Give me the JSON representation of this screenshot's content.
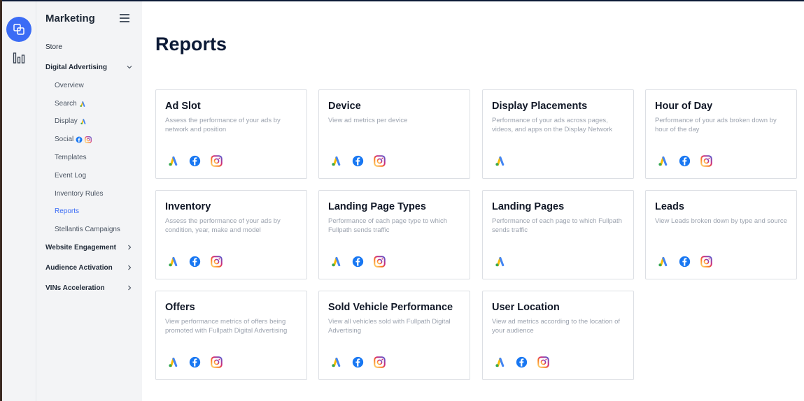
{
  "sidebar": {
    "title": "Marketing",
    "items": [
      {
        "label": "Store",
        "level": 0,
        "expandable": false
      },
      {
        "label": "Digital Advertising",
        "level": 0,
        "expandable": true,
        "expanded": true
      },
      {
        "label": "Overview",
        "level": 1
      },
      {
        "label": "Search",
        "level": 1,
        "icons": [
          "google-ads-icon"
        ]
      },
      {
        "label": "Display",
        "level": 1,
        "icons": [
          "google-ads-icon"
        ]
      },
      {
        "label": "Social",
        "level": 1,
        "icons": [
          "facebook-icon",
          "instagram-icon"
        ]
      },
      {
        "label": "Templates",
        "level": 1
      },
      {
        "label": "Event Log",
        "level": 1
      },
      {
        "label": "Inventory Rules",
        "level": 1
      },
      {
        "label": "Reports",
        "level": 1,
        "active": true
      },
      {
        "label": "Stellantis Campaigns",
        "level": 1
      },
      {
        "label": "Website Engagement",
        "level": 0,
        "expandable": true
      },
      {
        "label": "Audience Activation",
        "level": 0,
        "expandable": true
      },
      {
        "label": "VINs Acceleration",
        "level": 0,
        "expandable": true
      }
    ]
  },
  "main": {
    "title": "Reports",
    "cards": [
      {
        "title": "Ad Slot",
        "desc": "Assess the performance of your ads by network and position",
        "icons": [
          "google-ads-icon",
          "facebook-icon",
          "instagram-icon"
        ]
      },
      {
        "title": "Device",
        "desc": "View ad metrics per device",
        "icons": [
          "google-ads-icon",
          "facebook-icon",
          "instagram-icon"
        ]
      },
      {
        "title": "Display Placements",
        "desc": "Performance of your ads across pages, videos, and apps on the Display Network",
        "icons": [
          "google-ads-icon"
        ]
      },
      {
        "title": "Hour of Day",
        "desc": "Performance of your ads broken down by hour of the day",
        "icons": [
          "google-ads-icon",
          "facebook-icon",
          "instagram-icon"
        ]
      },
      {
        "title": "Inventory",
        "desc": "Assess the performance of your ads by condition, year, make and model",
        "icons": [
          "google-ads-icon",
          "facebook-icon",
          "instagram-icon"
        ]
      },
      {
        "title": "Landing Page Types",
        "desc": "Performance of each page type to which Fullpath sends traffic",
        "icons": [
          "google-ads-icon",
          "facebook-icon",
          "instagram-icon"
        ]
      },
      {
        "title": "Landing Pages",
        "desc": "Performance of each page to which Fullpath sends traffic",
        "icons": [
          "google-ads-icon"
        ]
      },
      {
        "title": "Leads",
        "desc": "View Leads broken down by type and source",
        "icons": [
          "google-ads-icon",
          "facebook-icon",
          "instagram-icon"
        ]
      },
      {
        "title": "Offers",
        "desc": "View performance metrics of offers being promoted with Fullpath Digital Advertising",
        "icons": [
          "google-ads-icon",
          "facebook-icon",
          "instagram-icon"
        ]
      },
      {
        "title": "Sold Vehicle Performance",
        "desc": "View all vehicles sold with Fullpath Digital Advertising",
        "icons": [
          "google-ads-icon",
          "facebook-icon",
          "instagram-icon"
        ]
      },
      {
        "title": "User Location",
        "desc": "View ad metrics according to the location of your audience",
        "icons": [
          "google-ads-icon",
          "facebook-icon",
          "instagram-icon"
        ]
      }
    ]
  },
  "colors": {
    "accent": "#3b6cf5",
    "facebook": "#1877f2",
    "google_blue": "#4285f4",
    "google_yellow": "#fbbc04",
    "google_green": "#34a853"
  }
}
